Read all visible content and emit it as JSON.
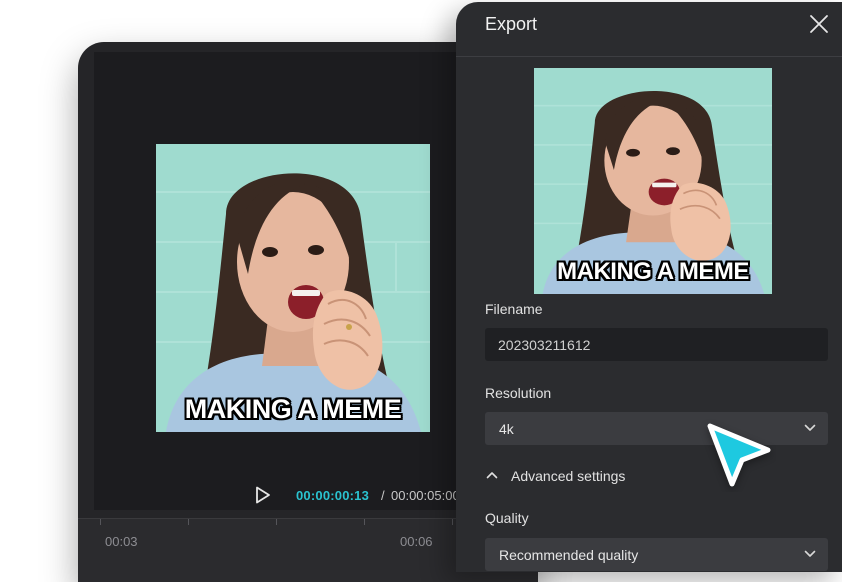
{
  "colors": {
    "accent_cyan": "#2ac2cf",
    "panel_bg": "#2b2c2f",
    "editor_bg": "#252528",
    "input_bg": "#1f2023",
    "select_bg": "#3b3c40"
  },
  "editor": {
    "meme_caption": "MAKING A MEME",
    "player": {
      "current_time": "00:00:00:13",
      "separator": "/",
      "total_time": "00:00:05:00"
    },
    "timeline": {
      "ruler_labels": [
        "00:03",
        "00:06"
      ]
    }
  },
  "export_panel": {
    "title": "Export",
    "close_icon": "close-icon",
    "thumbnail_caption": "MAKING A MEME",
    "filename": {
      "label": "Filename",
      "value": "202303211612"
    },
    "resolution": {
      "label": "Resolution",
      "selected": "4k"
    },
    "advanced_settings": {
      "label": "Advanced settings",
      "expanded": true
    },
    "quality": {
      "label": "Quality",
      "selected": "Recommended quality"
    }
  },
  "cursor": {
    "icon": "pointer-cursor-icon",
    "color": "#1ec9e0"
  }
}
